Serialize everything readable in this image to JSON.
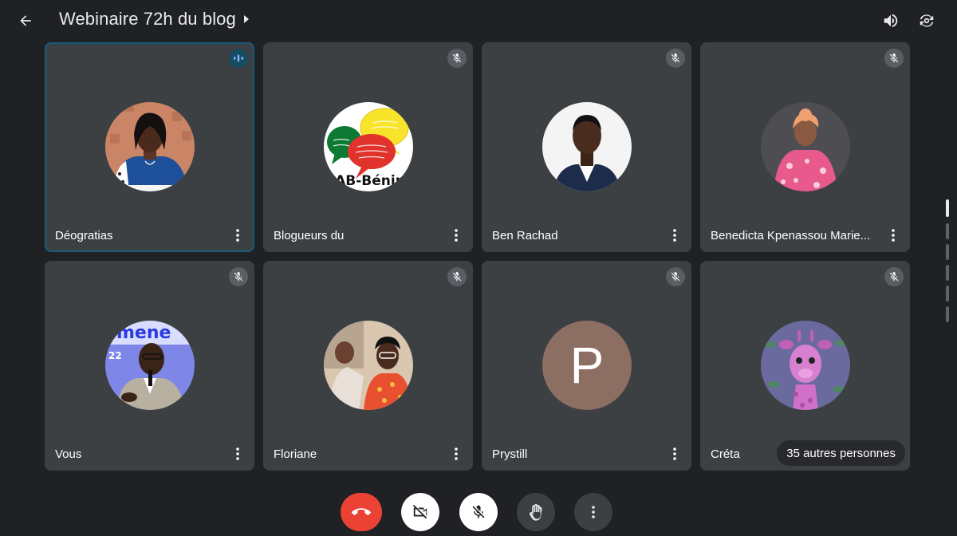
{
  "header": {
    "title": "Webinaire 72h du blog"
  },
  "participants": [
    {
      "name": "Déogratias",
      "status": "speaking"
    },
    {
      "name": "Blogueurs du",
      "status": "muted",
      "logo_text": "AB-Bénin"
    },
    {
      "name": "Ben Rachad",
      "status": "muted"
    },
    {
      "name": "Benedicta Kpenassou Marie...",
      "status": "muted"
    },
    {
      "name": "Vous",
      "status": "muted",
      "banner_text": "mene",
      "banner_num": "22"
    },
    {
      "name": "Floriane",
      "status": "muted"
    },
    {
      "name": "Prystill",
      "status": "muted",
      "initial": "P",
      "avatar_color": "#8d6e63"
    },
    {
      "name": "Créta",
      "status": "muted"
    }
  ],
  "others_chip": "35 autres personnes",
  "controls": [
    "end-call",
    "camera-off",
    "mic-off",
    "raise-hand",
    "more-options"
  ],
  "colors": {
    "background": "#202124",
    "tile": "#3c4043",
    "end_call": "#ea4335",
    "speaking_border": "#1a5a7a"
  }
}
